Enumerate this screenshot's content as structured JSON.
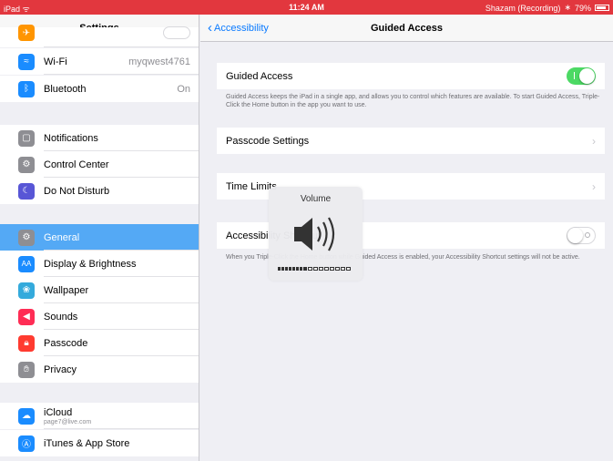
{
  "status_bar": {
    "device": "iPad",
    "time": "11:24 AM",
    "app_status": "Shazam (Recording)",
    "battery": "79%"
  },
  "left": {
    "title": "Settings",
    "items": [
      {
        "label": "Wi-Fi",
        "value": "myqwest4761",
        "icon": "wifi-icon",
        "color": "#1a8cff"
      },
      {
        "label": "Bluetooth",
        "value": "On",
        "icon": "bluetooth-icon",
        "color": "#1a8cff"
      },
      {
        "label": "Notifications",
        "icon": "notifications-icon",
        "color": "#8e8e93"
      },
      {
        "label": "Control Center",
        "icon": "control-center-icon",
        "color": "#8e8e93"
      },
      {
        "label": "Do Not Disturb",
        "icon": "moon-icon",
        "color": "#5856d6"
      },
      {
        "label": "General",
        "icon": "gear-icon",
        "color": "#8e8e93"
      },
      {
        "label": "Display & Brightness",
        "icon": "display-icon",
        "color": "#1a8cff"
      },
      {
        "label": "Wallpaper",
        "icon": "wallpaper-icon",
        "color": "#34aadc"
      },
      {
        "label": "Sounds",
        "icon": "speaker-icon",
        "color": "#ff2d55"
      },
      {
        "label": "Passcode",
        "icon": "lock-icon",
        "color": "#ff3b30"
      },
      {
        "label": "Privacy",
        "icon": "hand-icon",
        "color": "#8e8e93"
      },
      {
        "label": "iCloud",
        "sublabel": "page7@live.com",
        "icon": "cloud-icon",
        "color": "#1a8cff"
      },
      {
        "label": "iTunes & App Store",
        "icon": "app-store-icon",
        "color": "#1a8cff"
      }
    ],
    "selected": "General"
  },
  "right": {
    "back_label": "Accessibility",
    "title": "Guided Access",
    "guided_access": {
      "label": "Guided Access",
      "enabled": true
    },
    "guided_footer": "Guided Access keeps the iPad in a single app, and allows you to control which features are available. To start Guided Access, Triple-Click the Home button in the app you want to use.",
    "passcode_label": "Passcode Settings",
    "time_limits_label": "Time Limits",
    "accessibility_shortcut": {
      "label": "Accessibility Shortcut",
      "enabled": false
    },
    "shortcut_footer": "When you Triple-Click the Home button while Guided Access is enabled, your Accessibility Shortcut settings will not be active."
  },
  "hud": {
    "title": "Volume",
    "level": 0.5,
    "icon": "speaker-volume-icon"
  },
  "colors": {
    "status_bar": "#e2373e",
    "selection": "#54a9f5",
    "toggle_on": "#4cd964",
    "link": "#0a7aff"
  }
}
